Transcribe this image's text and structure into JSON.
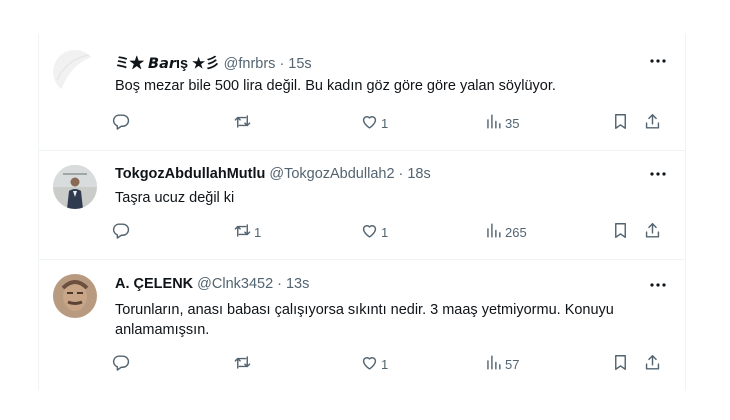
{
  "tweets": [
    {
      "name": "ミ★ 𝘽𝙖𝙧ış ★彡",
      "handle": "@fnrbrs",
      "separator": "·",
      "time": "15s",
      "text": "Boş mezar bile 500 lira değil. Bu kadın göz göre göre yalan söylüyor.",
      "replies": "",
      "retweets": "",
      "likes": "1",
      "views": "35"
    },
    {
      "name": "TokgozAbdullahMutlu",
      "handle": "@TokgozAbdullah2",
      "separator": "·",
      "time": "18s",
      "text": "Taşra ucuz değil ki",
      "replies": "",
      "retweets": "1",
      "likes": "1",
      "views": "265"
    },
    {
      "name": "A. ÇELENK",
      "handle": "@Clnk3452",
      "separator": "·",
      "time": "13s",
      "text": "Torunların, anası babası çalışıyorsa sıkıntı nedir. 3 maaş yetmiyormu. Konuyu anlamamışsın.",
      "replies": "",
      "retweets": "",
      "likes": "1",
      "views": "57"
    }
  ],
  "icons": {
    "reply": "reply-icon",
    "retweet": "retweet-icon",
    "like": "heart-icon",
    "views": "views-icon",
    "bookmark": "bookmark-icon",
    "share": "share-icon",
    "more": "more-icon"
  },
  "colors": {
    "text": "#0f1419",
    "secondary": "#536471",
    "divider": "#eff3f4"
  }
}
